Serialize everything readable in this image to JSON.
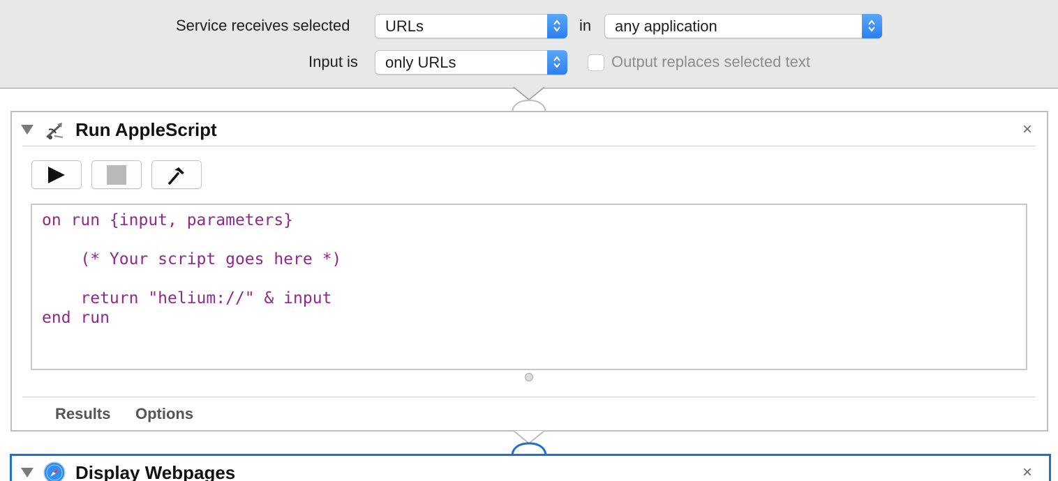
{
  "settings": {
    "receives_label": "Service receives selected",
    "receives_value": "URLs",
    "in_label": "in",
    "app_value": "any application",
    "input_label": "Input is",
    "input_value": "only URLs",
    "output_checkbox_label": "Output replaces selected text",
    "output_checked": false
  },
  "actions": [
    {
      "title": "Run AppleScript",
      "icon": "applescript-icon",
      "close": "×",
      "toolbar": [
        "run-icon",
        "stop-icon",
        "compile-icon"
      ],
      "code": [
        "on run {input, parameters}",
        "",
        "    (* Your script goes here *)",
        "",
        "    return \"helium://\" & input",
        "end run"
      ],
      "tabs": [
        "Results",
        "Options"
      ]
    },
    {
      "title": "Display Webpages",
      "icon": "safari-compass-icon",
      "close": "×",
      "selected": true
    }
  ],
  "colors": {
    "accent": "#2d7ff0",
    "selection_border": "#1f6ed4",
    "code": "#91278f",
    "topbar_bg": "#e8e8e8"
  }
}
